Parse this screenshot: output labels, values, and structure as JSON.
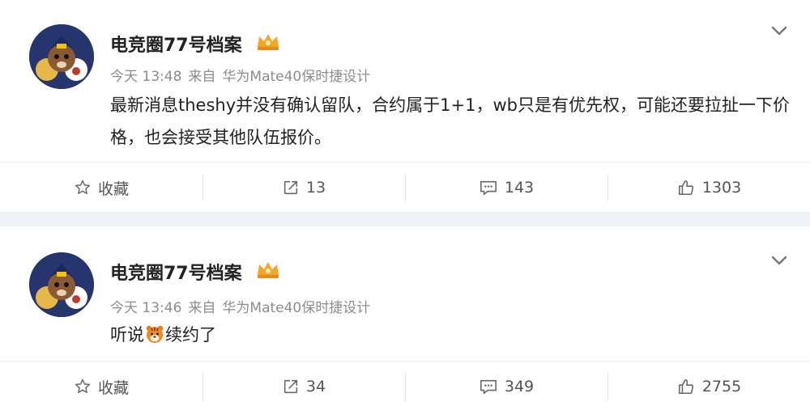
{
  "posts": [
    {
      "username": "电竞圈77号档案",
      "time": "今天 13:48",
      "via": "来自",
      "device": "华为Mate40保时捷设计",
      "text": "最新消息theshy并没有确认留队，合约属于1+1，wb只是有优先权，可能还要拉扯一下价格，也会接受其他队伍报价。",
      "actions": {
        "favorite": "收藏",
        "repost": "13",
        "comment": "143",
        "like": "1303"
      }
    },
    {
      "username": "电竞圈77号档案",
      "time": "今天 13:46",
      "via": "来自",
      "device": "华为Mate40保时捷设计",
      "text_before": "听说",
      "text_after": "续约了",
      "emoji": "tiger-face-icon",
      "actions": {
        "favorite": "收藏",
        "repost": "34",
        "comment": "349",
        "like": "2755"
      }
    }
  ],
  "colors": {
    "page_bg": "#eef2f6",
    "card_bg": "#ffffff",
    "text": "#222222",
    "meta": "#8c8c8c",
    "badge": "#f5a623"
  }
}
